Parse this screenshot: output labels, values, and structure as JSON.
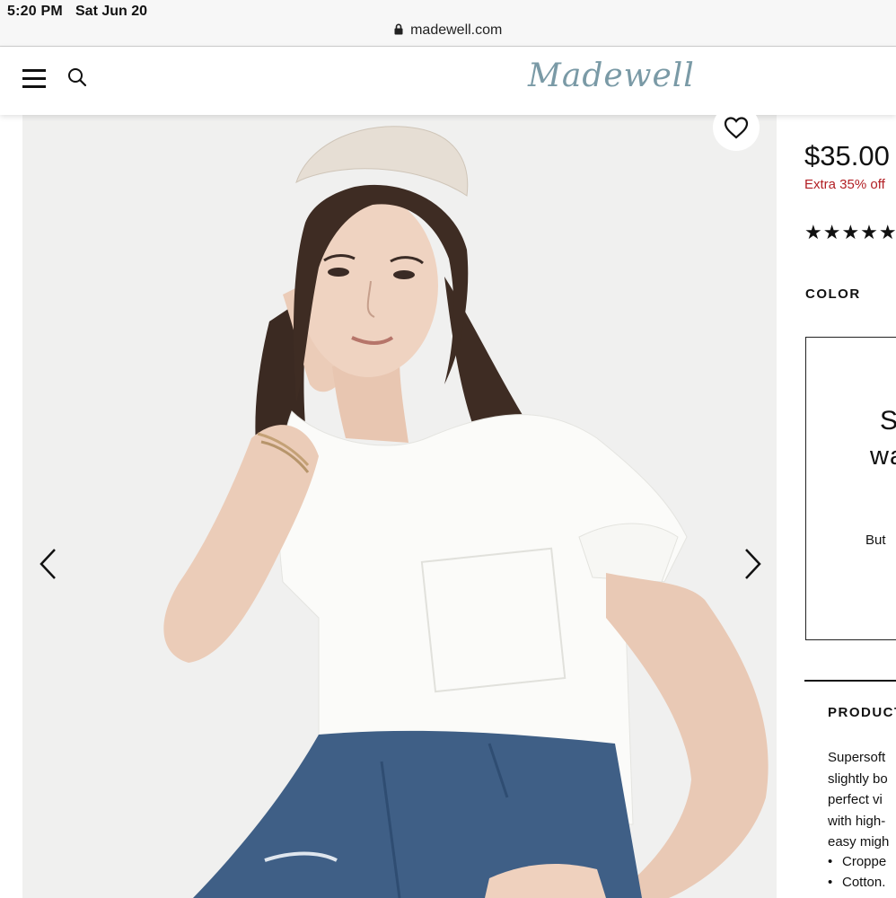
{
  "statusbar": {
    "time": "5:20 PM",
    "date": "Sat Jun 20",
    "url": "madewell.com"
  },
  "header": {
    "logo_text": "Madewell",
    "logo_colors": [
      "#7a9aa6",
      "#b98e7b",
      "#d4a98a",
      "#a9b7c3"
    ]
  },
  "product": {
    "price": "$35.00",
    "promo_text": "Extra 35% off",
    "rating_stars": "★★★★★",
    "color_label": "COLOR",
    "swatch_text": {
      "line1": "S",
      "line2": "wa",
      "line3": "But"
    },
    "details_title": "PRODUCT",
    "description_lines": [
      "Supersoft",
      "slightly bo",
      "perfect vi",
      "with high-",
      "easy migh"
    ],
    "bullet_items": [
      "Croppe",
      "Cotton."
    ]
  },
  "colors": {
    "promo": "#b21f24",
    "text": "#111111"
  }
}
